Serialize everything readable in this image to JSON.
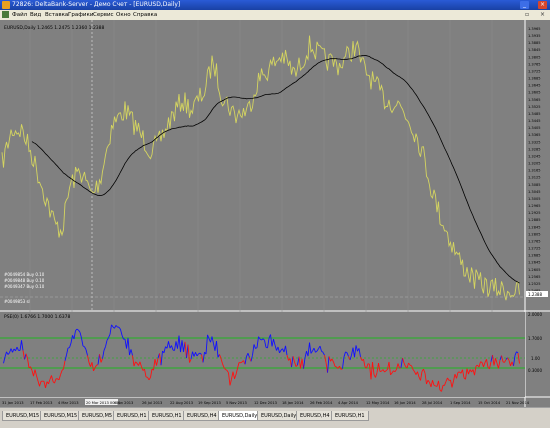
{
  "window": {
    "title": "72826: DeltaBank-Server - Демо Счет - [EURUSD,Daily]"
  },
  "menu": [
    {
      "label": "Файл"
    },
    {
      "label": "Вид"
    },
    {
      "label": "Вставка"
    },
    {
      "label": "Графики"
    },
    {
      "label": "Сервис"
    },
    {
      "label": "Окно"
    },
    {
      "label": "Справка"
    }
  ],
  "main_chart": {
    "header": "EURUSD,Daily  1.2465 1.2475 1.2360 1.2388",
    "price_labels": [
      "1.3965",
      "1.3935",
      "1.3885",
      "1.3845",
      "1.3805",
      "1.3765",
      "1.3725",
      "1.3685",
      "1.3645",
      "1.3605",
      "1.3565",
      "1.3525",
      "1.3485",
      "1.3445",
      "1.3405",
      "1.3365",
      "1.3325",
      "1.3285",
      "1.3245",
      "1.3205",
      "1.3165",
      "1.3125",
      "1.3085",
      "1.3045",
      "1.3005",
      "1.2965",
      "1.2925",
      "1.2885",
      "1.2845",
      "1.2805",
      "1.2765",
      "1.2725",
      "1.2685",
      "1.2645",
      "1.2605",
      "1.2565",
      "1.2525",
      "1.2485"
    ],
    "current_price": "1.2388",
    "legend": [
      "#0049854  Buy  0.10",
      "#0049848  Buy  0.10",
      "#0049347  Buy  0.10",
      "#0049853  sl"
    ]
  },
  "indicator": {
    "header": "PSE(0)  1.6766  1.7000  1.6378",
    "levels": [
      "2.0000",
      "1.7000",
      "1.00",
      "0.3000"
    ]
  },
  "time_axis": {
    "labels": [
      "31 Jan 2013",
      "17 Feb 2013",
      "4 Mar 2013",
      "20 Mar 2013 00:00",
      "6 Jun 2013",
      "26 Jul 2013",
      "22 Aug 2013",
      "19 Sep 2013",
      "5 Nov 2013",
      "12 Dec 2013",
      "18 Jan 2014",
      "26 Feb 2014",
      "4 Apr 2014",
      "12 May 2014",
      "16 Jun 2014",
      "28 Jul 2014",
      "1 Sep 2014",
      "15 Oct 2014",
      "21 Nov 2014"
    ],
    "highlighted": "20 Mar 2013 00:00"
  },
  "tabs": [
    {
      "label": "EURUSD,M15",
      "active": false
    },
    {
      "label": "EURUSD,M15",
      "active": false
    },
    {
      "label": "EURUSD,M5",
      "active": false
    },
    {
      "label": "EURUSD,H1",
      "active": false
    },
    {
      "label": "EURUSD,H1",
      "active": false
    },
    {
      "label": "EURUSD,H4",
      "active": false
    },
    {
      "label": "EURUSD,Daily",
      "active": true
    },
    {
      "label": "EURUSD,Daily",
      "active": false
    },
    {
      "label": "EURUSD,H4",
      "active": false
    },
    {
      "label": "EURUSD,H1",
      "active": false
    }
  ],
  "colors": {
    "chart_bg": "#808080",
    "price": "#d4d460",
    "ma": "#000000",
    "osc_up": "#1010ff",
    "osc_down": "#ff1010",
    "level_line": "#00c800",
    "grid": "#a8a8a8"
  },
  "icons": [
    "app-icon",
    "minimize-icon",
    "close-icon",
    "doc-icon"
  ]
}
